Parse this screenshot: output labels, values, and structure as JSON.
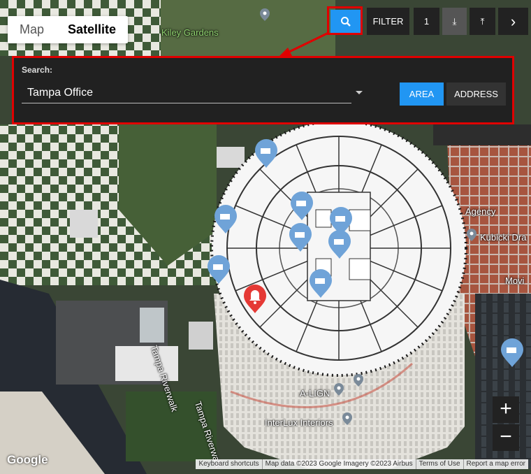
{
  "map_type": {
    "map_label": "Map",
    "satellite_label": "Satellite",
    "selected": "Satellite"
  },
  "toolbar": {
    "filter_label": "FILTER",
    "count": "1",
    "down_glyph": "⤓",
    "up_glyph": "⤒",
    "next_glyph": "›",
    "search_icon": "search-icon"
  },
  "search_panel": {
    "label": "Search:",
    "selected_value": "Tampa Office",
    "area_label": "AREA",
    "address_label": "ADDRESS"
  },
  "place_labels": [
    "Kiley Gardens",
    "Agency",
    "Kubicki Dra",
    "Movi",
    "A-LIGN",
    "InterLux Interiors",
    "Tampa Riverwalk",
    "Tampa Riverwalk"
  ],
  "zoom": {
    "in_label": "+",
    "out_label": "−"
  },
  "google_logo": "Google",
  "attribution": [
    "Keyboard shortcuts",
    "Map data ©2023 Google Imagery ©2023 Airbus",
    "Terms of Use",
    "Report a map error"
  ],
  "colors": {
    "accent": "#2196f3",
    "highlight": "#e00000",
    "alarm": "#e53935",
    "camera_marker": "#6fa3d8",
    "panel": "#212121"
  }
}
